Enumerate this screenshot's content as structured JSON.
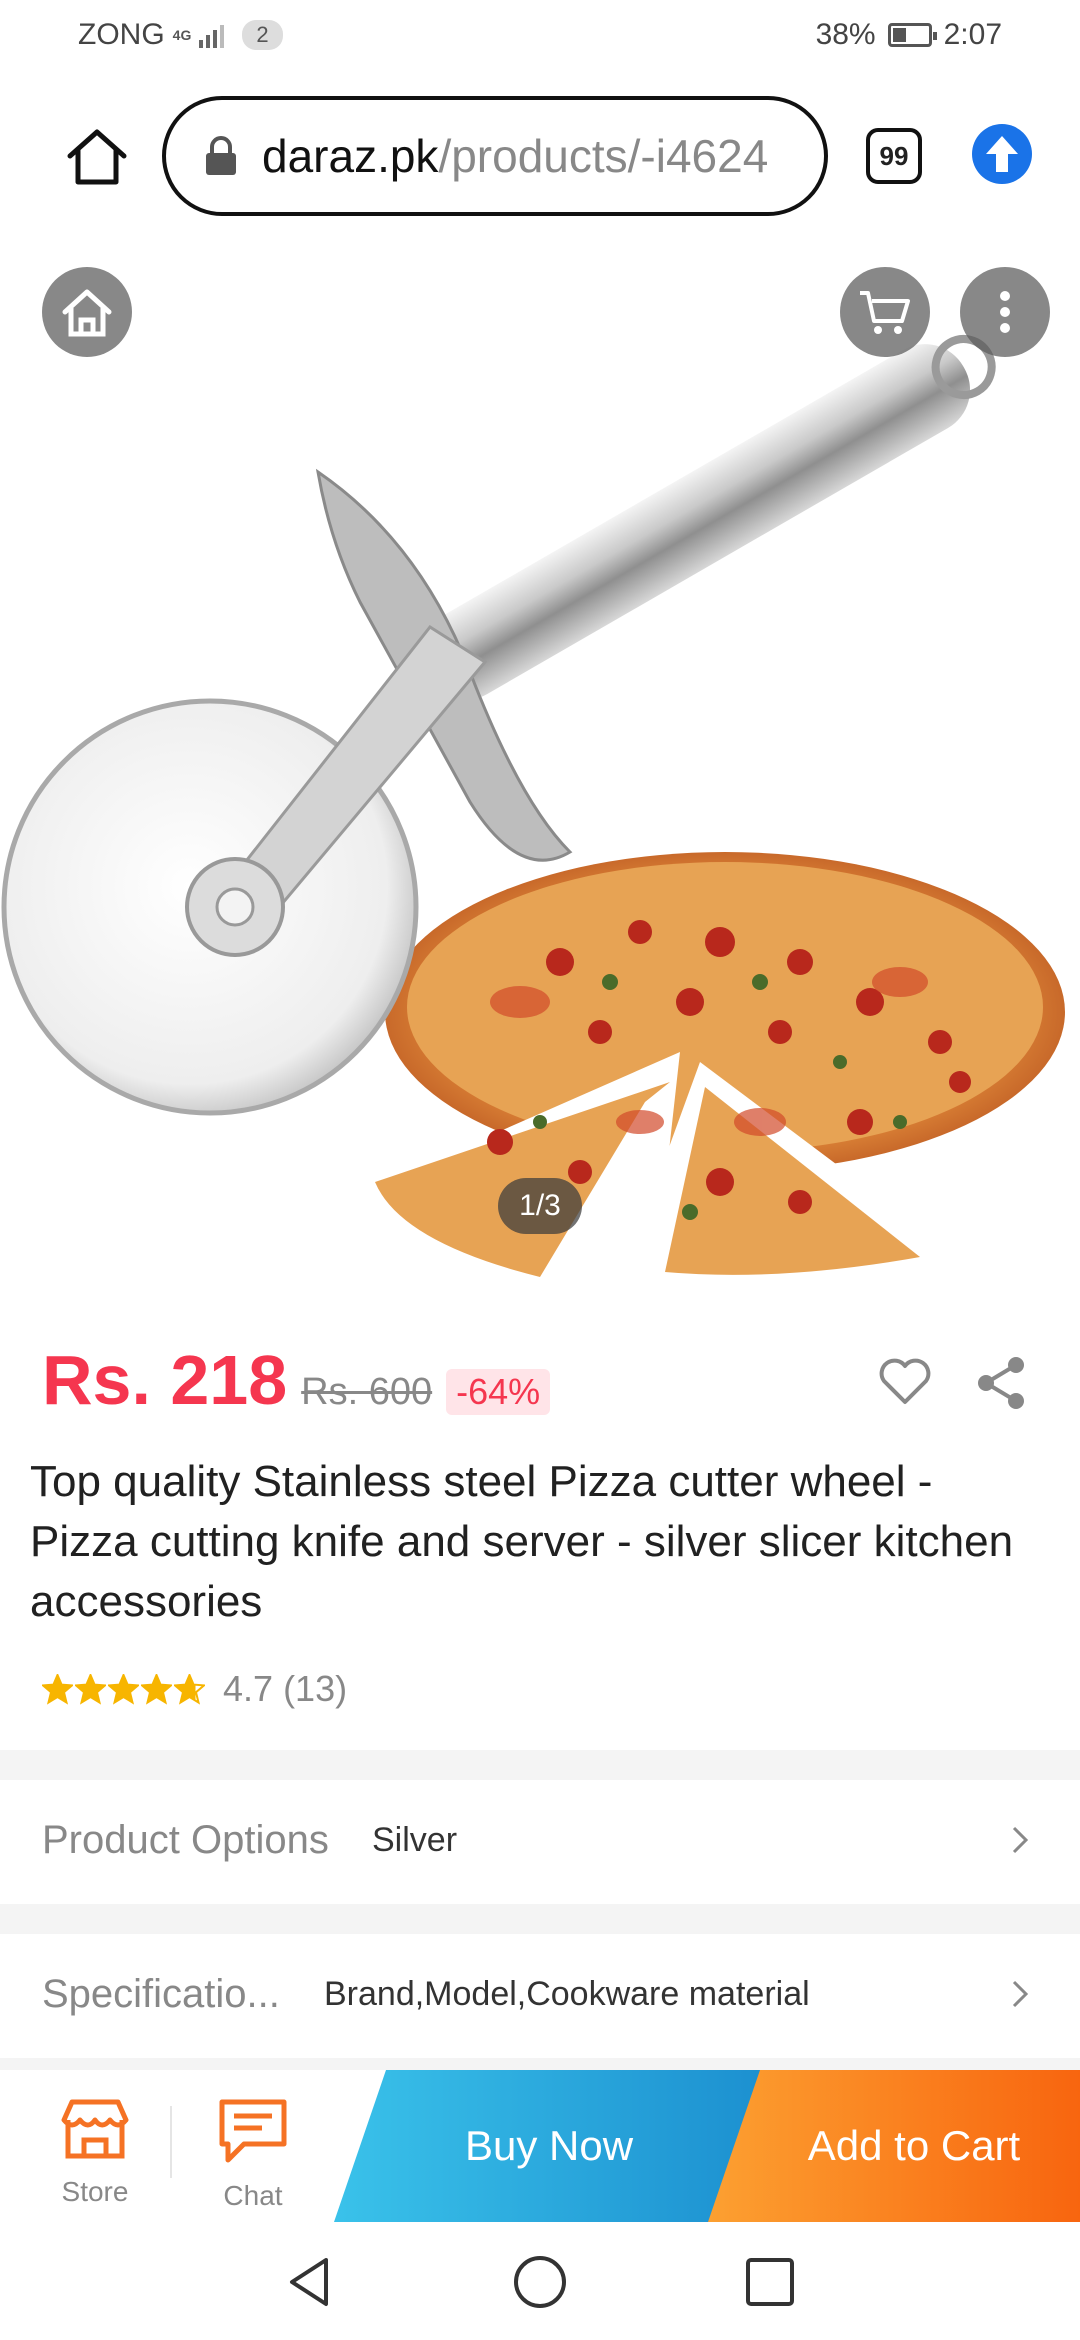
{
  "status_bar": {
    "carrier": "ZONG",
    "network": "4G",
    "sim_badge": "2",
    "battery": "38%",
    "battery_level": 0.38,
    "time": "2:07"
  },
  "browser": {
    "url_domain": "daraz.pk",
    "url_path": "/products/-i4624",
    "tab_count": "99",
    "icons": {
      "home": "home-icon",
      "lock": "lock-icon",
      "update": "arrow-up-icon"
    }
  },
  "gallery": {
    "counter": "1/3",
    "icons": {
      "home": "home-icon",
      "cart": "cart-icon",
      "menu": "more-vertical-icon"
    }
  },
  "product": {
    "price": "Rs. 218",
    "old_price": "Rs. 600",
    "discount": "-64%",
    "title": "Top quality Stainless steel Pizza cutter wheel - Pizza cutting knife and server - silver slicer kitchen accessories",
    "rating": "4.7",
    "rating_value": 4.7,
    "review_count": "(13)"
  },
  "options": {
    "label": "Product Options",
    "value": "Silver"
  },
  "specifications": {
    "label": "Specificatio...",
    "value": "Brand,Model,Cookware material"
  },
  "actions": {
    "store_label": "Store",
    "chat_label": "Chat",
    "buy_now": "Buy Now",
    "add_to_cart": "Add to Cart"
  },
  "colors": {
    "price": "#f5364f",
    "action_orange": "#f8650f",
    "buy_blue": "#1c90d0",
    "star": "#f7b500"
  }
}
